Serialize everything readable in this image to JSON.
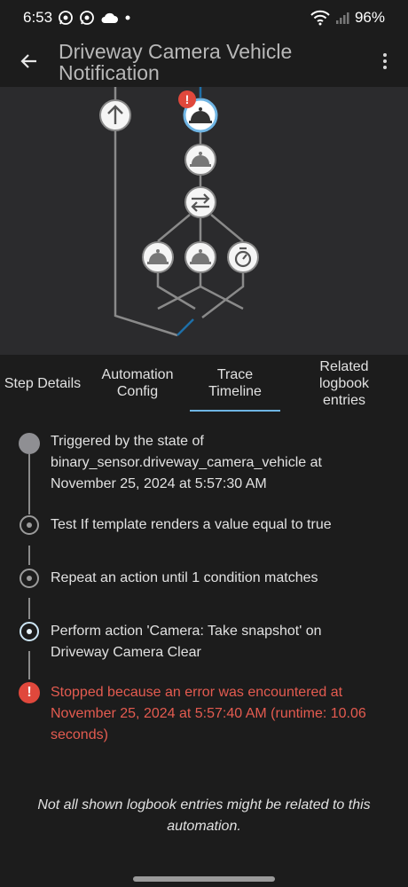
{
  "status_bar": {
    "time": "6:53",
    "battery": "96%",
    "left_icons": [
      "whatsapp-icon",
      "whatsapp-icon",
      "cloud-icon",
      "dot-icon"
    ],
    "right_icons": [
      "wifi-icon",
      "signal-icon"
    ]
  },
  "app_bar": {
    "title": "Driveway Camera Vehicle Notification",
    "back_icon": "arrow-left-icon",
    "more_icon": "more-vertical-icon"
  },
  "graph": {
    "nodes": [
      {
        "name": "trigger-node",
        "icon": "arrow-up-icon"
      },
      {
        "name": "condition-node-error",
        "icon": "bell-ring-icon",
        "state": "error"
      },
      {
        "name": "action-node",
        "icon": "bell-ring-icon"
      },
      {
        "name": "repeat-node",
        "icon": "shuffle-icon"
      },
      {
        "name": "branch-node-1",
        "icon": "bell-ring-icon"
      },
      {
        "name": "branch-node-2",
        "icon": "bell-ring-icon"
      },
      {
        "name": "branch-node-3",
        "icon": "timer-icon"
      }
    ],
    "colors": {
      "background": "#2b2b2d",
      "line": "#8a8a8a",
      "active_line": "#1e6fa8",
      "error": "#e0483c"
    }
  },
  "tabs": [
    {
      "label": "Step Details",
      "active": false
    },
    {
      "label": "Automation Config",
      "active": false
    },
    {
      "label": "Trace Timeline",
      "active": true
    },
    {
      "label": "Related logbook entries",
      "active": false
    }
  ],
  "timeline": [
    {
      "text": "Triggered by the state of binary_sensor.driveway_camera_vehicle at November 25, 2024 at 5:57:30 AM",
      "type": "trigger"
    },
    {
      "text": "Test If template renders a value equal to true",
      "type": "step"
    },
    {
      "text": "Repeat an action until 1 condition matches",
      "type": "step"
    },
    {
      "text": "Perform action 'Camera: Take snapshot' on Driveway Camera Clear",
      "type": "active"
    },
    {
      "text": "Stopped because an error was encountered at November 25, 2024 at 5:57:40 AM (runtime: 10.06 seconds)",
      "type": "error"
    }
  ],
  "footnote": "Not all shown logbook entries might be related to this automation.",
  "error_glyph": "!"
}
